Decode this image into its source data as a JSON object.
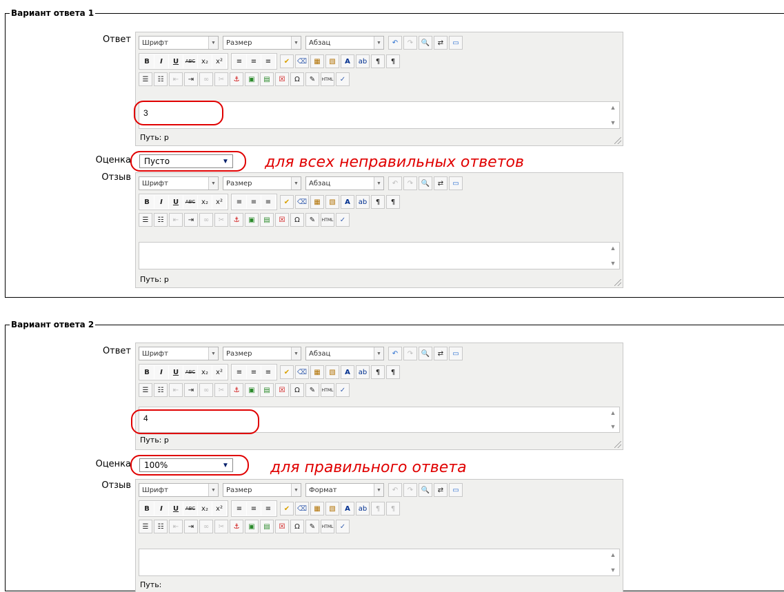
{
  "toolbar": {
    "font_select": "Шрифт",
    "size_select": "Размер",
    "paragraph_select": "Абзац",
    "format_select": "Формат",
    "bold": "B",
    "italic": "I",
    "underline": "U",
    "strike": "ABC",
    "subscript": "x₂",
    "superscript": "x²",
    "omega": "Ω",
    "html": "HTML"
  },
  "path_label_p": "Путь: р",
  "path_label_empty": "Путь:",
  "answers": [
    {
      "legend": "Вариант ответа 1",
      "answer_label": "Ответ",
      "answer_value": "3",
      "grade_label": "Оценка",
      "grade_value": "Пусто",
      "feedback_label": "Отзыв",
      "annotation": "для всех неправильных ответов"
    },
    {
      "legend": "Вариант ответа 2",
      "answer_label": "Ответ",
      "answer_value": "4",
      "grade_label": "Оценка",
      "grade_value": "100%",
      "feedback_label": "Отзыв",
      "annotation": "для правильного ответа"
    }
  ],
  "colors": {
    "annotation": "#e00000",
    "border": "#000000"
  }
}
